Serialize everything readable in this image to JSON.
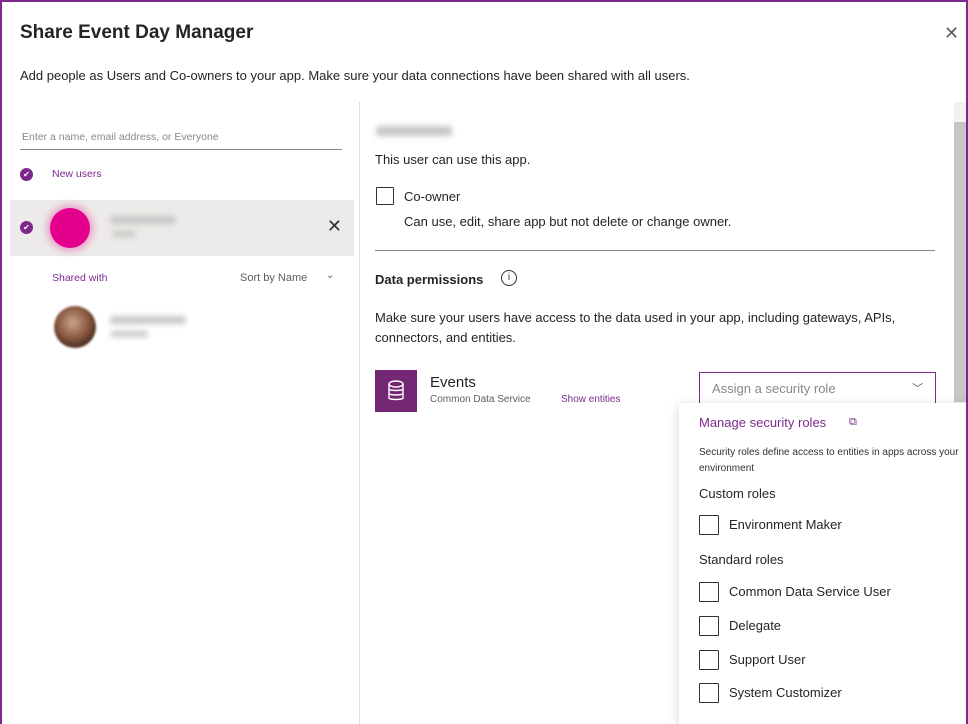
{
  "dialog": {
    "title": "Share Event Day Manager",
    "close_icon": "close-icon",
    "subtitle": "Add people as Users and Co-owners to your app. Make sure your data connections have been shared with all users."
  },
  "left_panel": {
    "search_placeholder": "Enter a name, email address, or Everyone",
    "new_users_label": "New users",
    "shared_with_label": "Shared with",
    "sort_label": "Sort by Name"
  },
  "right_panel": {
    "user_can_use": "This user can use this app.",
    "coowner_label": "Co-owner",
    "coowner_desc": "Can use, edit, share app but not delete or change owner.",
    "data_permissions_title": "Data permissions",
    "data_permissions_desc": "Make sure your users have access to the data used in your app, including gateways, APIs, connectors, and entities.",
    "data_source": {
      "name": "Events",
      "type": "Common Data Service",
      "show_entities": "Show entities",
      "icon": "database-icon"
    },
    "security_role_placeholder": "Assign a security role"
  },
  "role_dropdown": {
    "manage_link": "Manage security roles",
    "description": "Security roles define access to entities in apps across your environment",
    "custom_roles_label": "Custom roles",
    "custom_roles": [
      "Environment Maker"
    ],
    "standard_roles_label": "Standard roles",
    "standard_roles": [
      "Common Data Service User",
      "Delegate",
      "Support User",
      "System Customizer"
    ]
  },
  "colors": {
    "accent": "#7b2a8c",
    "avatar_pink": "#e3008c",
    "datasource_icon_bg": "#742774"
  }
}
